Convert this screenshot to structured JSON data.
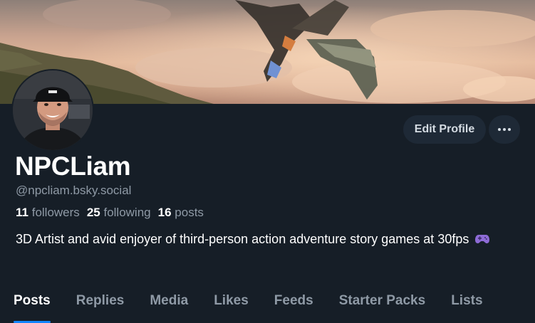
{
  "profile": {
    "display_name": "NPCLiam",
    "handle": "@npcliam.bsky.social",
    "followers_count": "11",
    "followers_label": "followers",
    "following_count": "25",
    "following_label": "following",
    "posts_count": "16",
    "posts_label": "posts",
    "bio": "3D Artist and avid enjoyer of third-person action adventure story games at 30fps",
    "bio_emoji": "gamepad-icon"
  },
  "actions": {
    "edit_label": "Edit Profile",
    "more_icon": "more-horizontal-icon"
  },
  "tabs": [
    {
      "label": "Posts",
      "active": true
    },
    {
      "label": "Replies"
    },
    {
      "label": "Media"
    },
    {
      "label": "Likes"
    },
    {
      "label": "Feeds"
    },
    {
      "label": "Starter Packs"
    },
    {
      "label": "Lists"
    }
  ],
  "colors": {
    "background": "#161e27",
    "accent": "#1185fe",
    "muted_text": "#8f9aa6",
    "button_bg": "#1e2936"
  }
}
